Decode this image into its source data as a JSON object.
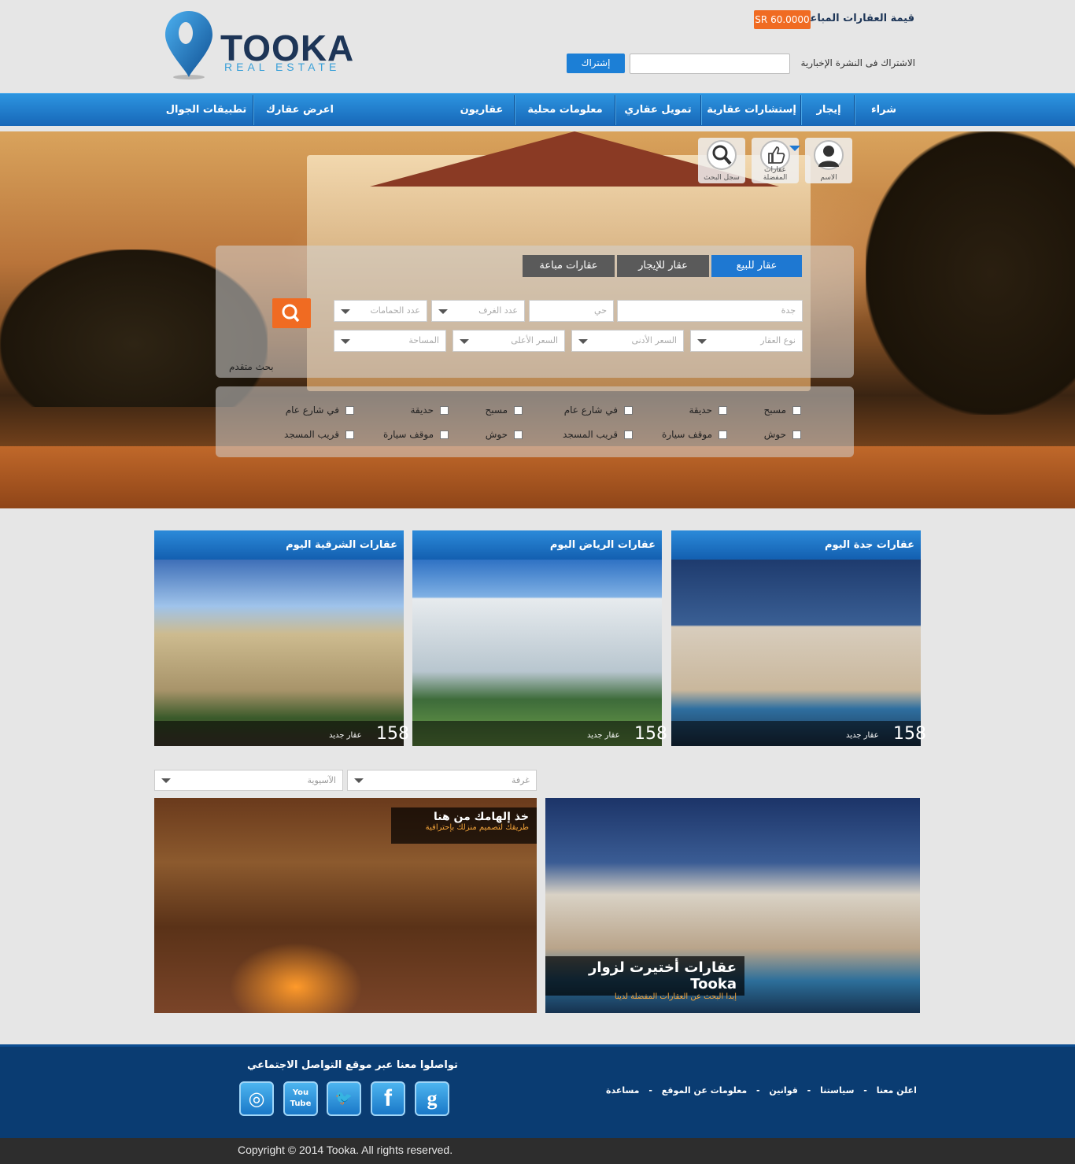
{
  "brand": {
    "name": "TOOKA",
    "tagline": "REAL ESTATE",
    "pin_color": "#1c7fd6"
  },
  "header": {
    "price_label": "قيمة العقارات المباعة",
    "price_value": "SR 60.0000",
    "newsletter_label": "الاشتراك فى النشرة الإخبارية",
    "newsletter_button": "إشتراك",
    "newsletter_input_value": ""
  },
  "nav": {
    "items": [
      "شراء",
      "إيجار",
      "إستشارات عقارية",
      "تمويل عقاري",
      "معلومات محلية",
      "عقاريون",
      "اعرض عقارك",
      "تطبيقات الجوال"
    ]
  },
  "hero": {
    "user_icons": [
      {
        "label": "الاسم",
        "icon": "user-icon"
      },
      {
        "label": "عقارات المفضلة",
        "icon": "thumbs-up-icon"
      },
      {
        "label": "سجل البحث",
        "icon": "search-icon"
      }
    ],
    "tabs": [
      "عقار للبيع",
      "عقار للإيجار",
      "عقارات مباعة"
    ],
    "fields": {
      "city": "جدة",
      "district": "حي",
      "rooms": "عدد الغرف",
      "baths": "عدد الحمامات",
      "type": "نوع العقار",
      "min_price": "السعر الأدنى",
      "max_price": "السعر الأعلى",
      "area": "المساحة"
    },
    "advanced_search": "بحث متقدم",
    "filters_row1": [
      "مسبح",
      "حديقة",
      "في شارع عام",
      "مسبح",
      "حديقة",
      "في شارع عام"
    ],
    "filters_row2": [
      "حوش",
      "موقف سيارة",
      "قريب المسجد",
      "حوش",
      "موقف سيارة",
      "قريب المسجد"
    ]
  },
  "cards": [
    {
      "title": "عقارات جدة اليوم",
      "count": "158",
      "count_label": "عقار جديد"
    },
    {
      "title": "عقارات الرياض اليوم",
      "count": "158",
      "count_label": "عقار جديد"
    },
    {
      "title": "عقارات الشرقية  اليوم",
      "count": "158",
      "count_label": "عقار جديد"
    }
  ],
  "dropdowns": {
    "room": "غرفة",
    "style": "الآسيوية"
  },
  "promos": {
    "inspiration_title": "خذ إلهامك من هنا",
    "inspiration_sub": "طريقك لتصميم منزلك بإحترافية",
    "featured_title": "عقارات أختيرت لزوار Tooka",
    "featured_sub": "إبدا البحث عن العقارات المفضلة لدينا"
  },
  "footer": {
    "social_title": "تواصلوا معنا عبر  موقع التواصل الاجتماعي",
    "social": [
      {
        "name": "google",
        "glyph": "g"
      },
      {
        "name": "facebook",
        "glyph": "f"
      },
      {
        "name": "twitter",
        "glyph": "🐦"
      },
      {
        "name": "youtube",
        "glyph": "You Tube"
      },
      {
        "name": "instagram",
        "glyph": "◎"
      }
    ],
    "links": [
      "اعلن معنا",
      "سياستنا",
      "قوانين",
      "معلومات عن الموقع",
      "مساعدة"
    ],
    "separator": "-",
    "copyright": "Copyright © 2014 Tooka. All rights reserved."
  }
}
